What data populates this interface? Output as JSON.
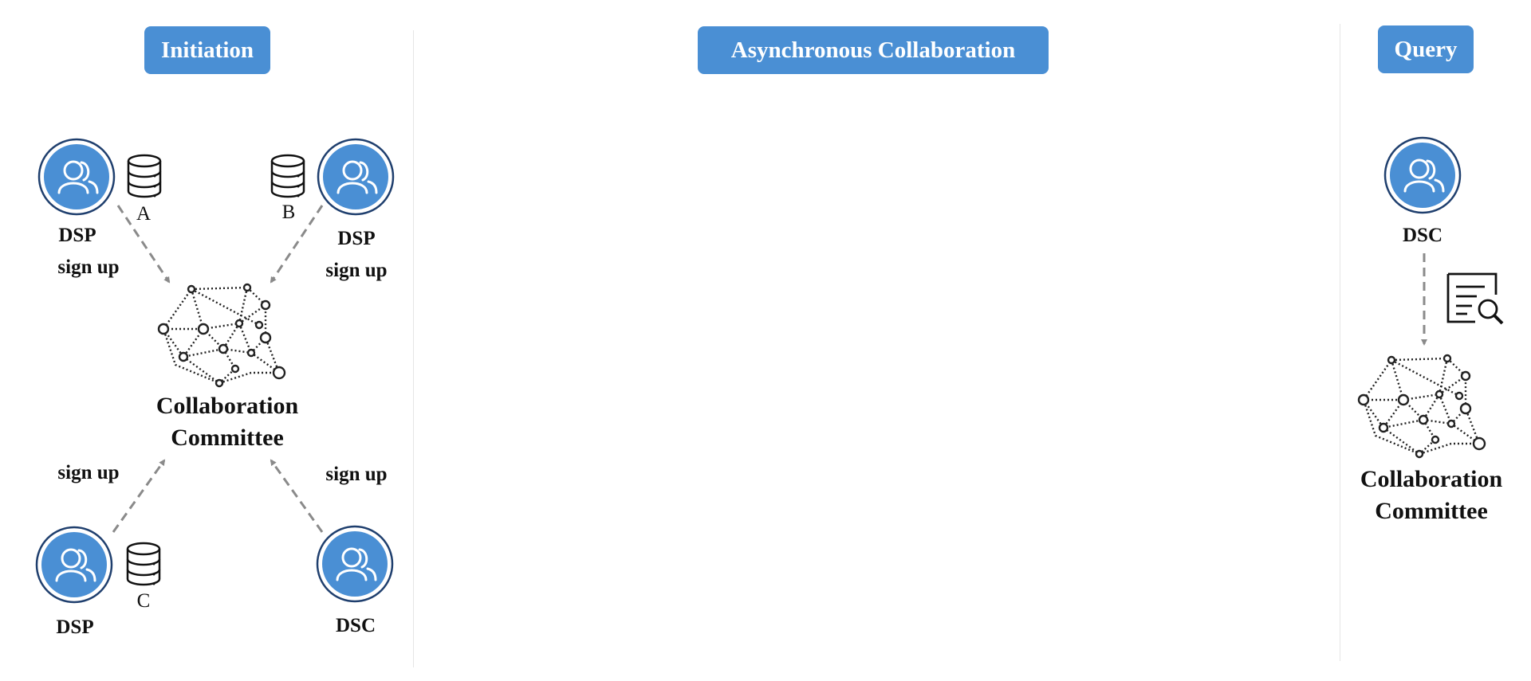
{
  "phases": {
    "initiation": "Initiation",
    "async": "Asynchronous Collaboration",
    "query": "Query"
  },
  "initiation": {
    "dsp_a_role": "DSP",
    "dsp_a_db": "A",
    "dsp_a_action": "sign up",
    "dsp_b_role": "DSP",
    "dsp_b_db": "B",
    "dsp_b_action": "sign up",
    "dsp_c_role": "DSP",
    "dsp_c_db": "C",
    "dsp_c_action": "sign up",
    "dsc_role": "DSC",
    "dsc_action": "sign up",
    "committee_line1": "Collaboration",
    "committee_line2": "Committee"
  },
  "query": {
    "dsc_role": "DSC",
    "committee_line1": "Collaboration",
    "committee_line2": "Committee"
  },
  "colors": {
    "accent": "#4a8fd4",
    "arrow": "#8a8a8a",
    "divider": "#e6e6e6"
  }
}
